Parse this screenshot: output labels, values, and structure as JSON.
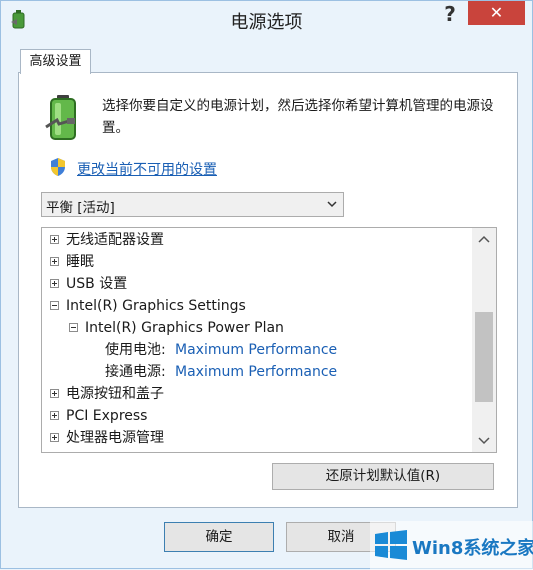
{
  "window": {
    "title": "电源选项",
    "help_label": "?",
    "close_label": "✕"
  },
  "tab": {
    "label": "高级设置"
  },
  "description": "选择你要自定义的电源计划，然后选择你希望计算机管理的电源设置。",
  "change_link": "更改当前不可用的设置",
  "plan_select": {
    "value": "平衡 [活动]"
  },
  "tree": {
    "items": [
      {
        "label": "无线适配器设置",
        "expander": "+"
      },
      {
        "label": "睡眠",
        "expander": "+"
      },
      {
        "label": "USB 设置",
        "expander": "+"
      },
      {
        "label": "Intel(R) Graphics Settings",
        "expander": "-"
      },
      {
        "label": "Intel(R) Graphics Power Plan",
        "expander": "-"
      },
      {
        "label": "使用电池:",
        "value": "Maximum Performance"
      },
      {
        "label": "接通电源:",
        "value": "Maximum Performance"
      },
      {
        "label": "电源按钮和盖子",
        "expander": "+"
      },
      {
        "label": "PCI Express",
        "expander": "+"
      },
      {
        "label": "处理器电源管理",
        "expander": "+"
      }
    ]
  },
  "buttons": {
    "restore": "还原计划默认值(R)",
    "ok": "确定",
    "cancel": "取消"
  },
  "watermark": {
    "text": "Win8系统之家"
  },
  "colors": {
    "accent": "#1a5fb4",
    "close_bg": "#c9443c",
    "window_bg": "#eaf3fb"
  }
}
